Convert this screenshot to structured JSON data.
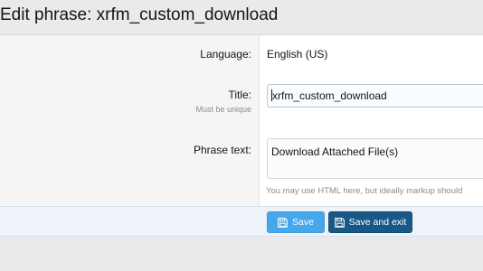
{
  "page": {
    "title": "Edit phrase: xrfm_custom_download"
  },
  "form": {
    "language": {
      "label": "Language:",
      "value": "English (US)"
    },
    "title": {
      "label": "Title:",
      "hint": "Must be unique",
      "value": "xrfm_custom_download"
    },
    "phrase_text": {
      "label": "Phrase text:",
      "value": "Download Attached File(s)",
      "explain": "You may use HTML here, but ideally markup should"
    }
  },
  "buttons": {
    "save": {
      "label": "Save",
      "icon": "save-icon"
    },
    "save_exit": {
      "label": "Save and exit",
      "icon": "save-icon"
    }
  },
  "colors": {
    "save_button": "#47a7eb",
    "save_exit_button": "#185886",
    "submit_bar": "#edf3f8"
  }
}
